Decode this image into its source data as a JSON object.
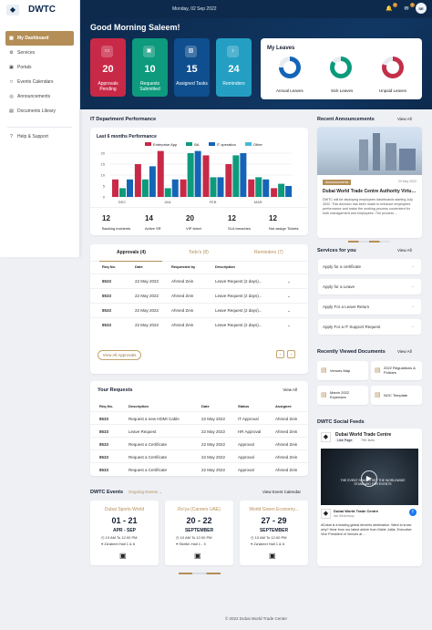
{
  "app": {
    "brand": "DWTC",
    "logo_icon": "dwtc-logo",
    "menu_icon": "menu"
  },
  "topbar": {
    "date": "Monday, 02 Sep 2022",
    "badge1": "4",
    "badge2": "4",
    "user_initials": "SE"
  },
  "greeting": "Good Morning Saleem!",
  "sidebar": {
    "items": [
      {
        "label": "My Dashboard",
        "icon": "dashboard"
      },
      {
        "label": "Services",
        "icon": "services"
      },
      {
        "label": "Portals",
        "icon": "portals"
      },
      {
        "label": "Events Calendars",
        "icon": "calendar"
      },
      {
        "label": "Announcements",
        "icon": "announcements"
      },
      {
        "label": "Documents Library",
        "icon": "document"
      },
      {
        "label": "Help & Support",
        "icon": "help"
      }
    ]
  },
  "stats": [
    {
      "value": "20",
      "label": "Approvals Pending",
      "color": "#c82947"
    },
    {
      "value": "10",
      "label": "Requests Submitted",
      "color": "#0d9a7d"
    },
    {
      "value": "15",
      "label": "Assigned Tasks",
      "color": "#0f4f8f"
    },
    {
      "value": "24",
      "label": "Reminders",
      "color": "#249fc3"
    }
  ],
  "leaves": {
    "title": "My Leaves",
    "items": [
      {
        "label": "Annual Leaves",
        "color": "#1465b7",
        "fraction": 0.75
      },
      {
        "label": "Sick Leaves",
        "color": "#0b9a7c",
        "fraction": 0.85
      },
      {
        "label": "Unpaid Leaves",
        "color": "#c2304a",
        "fraction": 0.8
      }
    ]
  },
  "performance": {
    "title": "IT Department Performance",
    "chart_title": "Last 6 months Performance",
    "stats": [
      {
        "value": "12",
        "label": "Backlog incidents"
      },
      {
        "value": "14",
        "label": "Active SR"
      },
      {
        "value": "20",
        "label": "VIP ticket"
      },
      {
        "value": "12",
        "label": "SLA breaches"
      },
      {
        "value": "12",
        "label": "Not assign Tickets"
      }
    ]
  },
  "chart_data": {
    "type": "bar",
    "title": "Last 6 months Performance",
    "categories": [
      "DEC",
      "",
      "JAN",
      "",
      "FEB",
      "",
      "MAR",
      ""
    ],
    "series": [
      {
        "name": "Enterprise App",
        "color": "#c82947",
        "values": [
          8,
          15,
          21,
          8,
          19,
          15,
          8,
          4
        ]
      },
      {
        "name": "BA",
        "color": "#0d9a7d",
        "values": [
          4,
          8,
          4,
          20,
          9,
          19,
          9,
          6
        ]
      },
      {
        "name": "IT operation",
        "color": "#1465b7",
        "values": [
          8,
          14,
          8,
          21,
          9,
          20,
          8,
          5
        ]
      },
      {
        "name": "Other",
        "color": "#49b8d7",
        "values": [
          0,
          0,
          0,
          0,
          0,
          0,
          0,
          0
        ]
      }
    ],
    "xlabel": "",
    "ylabel": "",
    "ylim": [
      0,
      20
    ],
    "yticks": [
      0,
      5,
      10,
      15,
      20
    ]
  },
  "approvals": {
    "tabs": [
      "Approvals (4)",
      "Todo's (8)",
      "Reminders (7)"
    ],
    "headers": [
      "Req No.",
      "Date",
      "Requested by",
      "Description"
    ],
    "rows": [
      [
        "8533",
        "22 May 2022",
        "Ahmed Zein",
        "Leave Request (2 days)..."
      ],
      [
        "8533",
        "22 May 2022",
        "Ahmed Zein",
        "Leave Request (2 days)..."
      ],
      [
        "8533",
        "22 May 2022",
        "Ahmed Zein",
        "Leave Request (2 days)..."
      ],
      [
        "8533",
        "22 May 2022",
        "Ahmed Zein",
        "Leave Request (2 days)..."
      ]
    ],
    "view_all": "View All Approvals"
  },
  "requests": {
    "title": "Your Requests",
    "view_all": "View All",
    "headers": [
      "Req No.",
      "Description",
      "Date",
      "Status",
      "Assignee"
    ],
    "rows": [
      [
        "8533",
        "Request a new HDMI Cable",
        "22 May 2022",
        "IT Approval",
        "Ahmed Zein"
      ],
      [
        "8533",
        "Leave Request",
        "22 May 2022",
        "HR Approval",
        "Ahmed Zein"
      ],
      [
        "8533",
        "Request a Certificate",
        "22 May 2022",
        "Approval",
        "Ahmed Zein"
      ],
      [
        "8533",
        "Request a Certificate",
        "22 May 2022",
        "Approval",
        "Ahmed Zein"
      ],
      [
        "8533",
        "Request a Certificate",
        "22 May 2022",
        "Approval",
        "Ahmed Zein"
      ]
    ]
  },
  "events": {
    "title": "DWTC Events",
    "filter": "Ongoing Events",
    "view_calendar": "View Event Calendar",
    "items": [
      {
        "title": "Dubai Sports World",
        "dates": "01 - 21",
        "month": "APR - SEP",
        "time": "10 AM To 12:00 PM",
        "venue": "Za'abeel Hall 1 & 6"
      },
      {
        "title": "Ro'ya (Careers UAE)",
        "dates": "20 - 22",
        "month": "SEPTEMBER",
        "time": "10 AM To 12:00 PM",
        "venue": "Sheikh Hall 1 - 3"
      },
      {
        "title": "World Green Economy...",
        "dates": "27 - 29",
        "month": "SEPTEMBER",
        "time": "10 AM To 12:00 PM",
        "venue": "Za'abeel Hall 1 & 6"
      }
    ]
  },
  "announcements": {
    "title": "Recent Announcements",
    "view_all": "View All",
    "tag": "Announcements",
    "date": "20 May 2022",
    "headline": "Dubai World Trade Centre Authority Virtual...",
    "text": "DWTC will be deploying employees dashboards starting July 2022. This decision has been made to enhance employees performance and make the working process convenient for both management and employees. The process ..."
  },
  "services": {
    "title": "Services for you",
    "view_all": "View All",
    "items": [
      "Apply for a certificate",
      "Apply for a Leave",
      "Apply For a Leave Return",
      "Apply For a IT Support Request"
    ]
  },
  "documents": {
    "title": "Recently Viewed Documents",
    "view_all": "View All",
    "items": [
      "Venues Map",
      "2022 Regulations & Policies",
      "March 2022 Expenses",
      "NOC Template"
    ]
  },
  "social": {
    "title": "DWTC Social Feeds",
    "page": "Dubai World Trade Centre",
    "like": "Like Page",
    "followers": "79K likes",
    "video_title": "THE EVENT SPACES SET THE WORLDWIDE STANDARD FOR EVENTS",
    "post_page": "Dubai World Trade Centre",
    "post_date": "last Wednesday",
    "post_text": "#Dubai is a leading global #events destination. Want to know why? Hear from our latest article from Mahir Julfar, Executive Vice President of Venues at ..."
  },
  "footer": "© 2022 Dubai World Trade Center"
}
